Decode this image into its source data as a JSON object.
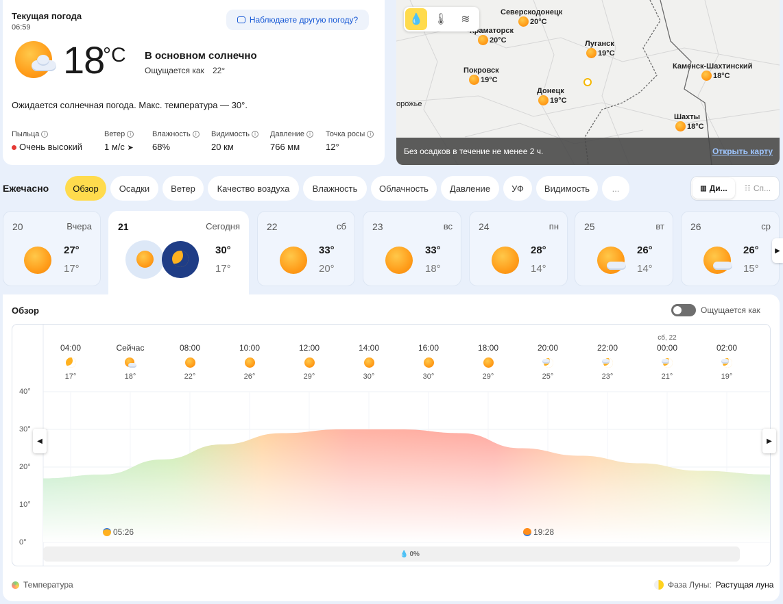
{
  "current": {
    "title": "Текущая погода",
    "time": "06:59",
    "feedback_label": "Наблюдаете другую погоду?",
    "temp": "18",
    "unit": "°C",
    "condition": "В основном солнечно",
    "feels_label": "Ощущается как",
    "feels_value": "22°",
    "expectation": "Ожидается солнечная погода. Макс. температура — 30°.",
    "details": [
      {
        "label": "Пыльца",
        "value": "Очень высокий"
      },
      {
        "label": "Ветер",
        "value": "1 м/с"
      },
      {
        "label": "Влажность",
        "value": "68%"
      },
      {
        "label": "Видимость",
        "value": "20 км"
      },
      {
        "label": "Давление",
        "value": "766 мм"
      },
      {
        "label": "Точка росы",
        "value": "12°"
      }
    ],
    "pollen_color": "#e53935"
  },
  "map": {
    "tools": [
      "drop-icon",
      "thermometer-icon",
      "wind-icon"
    ],
    "cities": [
      {
        "name": "Северскодонецк",
        "temp": "20°C"
      },
      {
        "name": "Краматорск",
        "temp": "20°C"
      },
      {
        "name": "Луганск",
        "temp": "19°C"
      },
      {
        "name": "Каменск-Шахтинский",
        "temp": "18°C"
      },
      {
        "name": "Покровск",
        "temp": "19°C"
      },
      {
        "name": "Донецк",
        "temp": "19°C"
      },
      {
        "name": "Шахты",
        "temp": "18°C"
      }
    ],
    "edge_label": "орожье",
    "status": "Без осадков в течение не менее 2 ч.",
    "open_link": "Открыть карту"
  },
  "hourly": {
    "label": "Ежечасно",
    "tabs": [
      "Обзор",
      "Осадки",
      "Ветер",
      "Качество воздуха",
      "Влажность",
      "Облачность",
      "Давление",
      "УФ",
      "Видимость",
      "..."
    ],
    "active_tab": "Обзор",
    "view_switch": [
      "Ди...",
      "Сп..."
    ]
  },
  "days": [
    {
      "num": "20",
      "name": "Вчера",
      "hi": "27°",
      "lo": "17°",
      "icon": "sun"
    },
    {
      "num": "21",
      "name": "Сегодня",
      "hi": "30°",
      "lo": "17°",
      "icon": "sun-moon"
    },
    {
      "num": "22",
      "name": "сб",
      "hi": "33°",
      "lo": "20°",
      "icon": "sun"
    },
    {
      "num": "23",
      "name": "вс",
      "hi": "33°",
      "lo": "18°",
      "icon": "sun"
    },
    {
      "num": "24",
      "name": "пн",
      "hi": "28°",
      "lo": "14°",
      "icon": "sun"
    },
    {
      "num": "25",
      "name": "вт",
      "hi": "26°",
      "lo": "14°",
      "icon": "sun-cloud"
    },
    {
      "num": "26",
      "name": "ср",
      "hi": "26°",
      "lo": "15°",
      "icon": "sun-cloud"
    }
  ],
  "overview": {
    "title": "Обзор",
    "feels_toggle": "Ощущается как",
    "hours": [
      {
        "date": "",
        "time": "04:00",
        "temp": "17°",
        "icon": "moon"
      },
      {
        "date": "",
        "time": "Сейчас",
        "temp": "18°",
        "icon": "sun-cloud"
      },
      {
        "date": "",
        "time": "08:00",
        "temp": "22°",
        "icon": "sun"
      },
      {
        "date": "",
        "time": "10:00",
        "temp": "26°",
        "icon": "sun"
      },
      {
        "date": "",
        "time": "12:00",
        "temp": "29°",
        "icon": "sun"
      },
      {
        "date": "",
        "time": "14:00",
        "temp": "30°",
        "icon": "sun"
      },
      {
        "date": "",
        "time": "16:00",
        "temp": "30°",
        "icon": "sun"
      },
      {
        "date": "",
        "time": "18:00",
        "temp": "29°",
        "icon": "sun"
      },
      {
        "date": "",
        "time": "20:00",
        "temp": "25°",
        "icon": "moon-cloud"
      },
      {
        "date": "",
        "time": "22:00",
        "temp": "23°",
        "icon": "moon-cloud"
      },
      {
        "date": "сб, 22",
        "time": "00:00",
        "temp": "21°",
        "icon": "moon-cloud"
      },
      {
        "date": "",
        "time": "02:00",
        "temp": "19°",
        "icon": "moon-cloud"
      }
    ],
    "sunrise": "05:26",
    "sunset": "19:28",
    "precip": "0%",
    "legend": "Температура",
    "moon_label": "Фаза Луны:",
    "moon_value": "Растущая луна"
  },
  "chart_data": {
    "type": "area",
    "ylabel": "",
    "y_ticks": [
      "40°",
      "30°",
      "20°",
      "10°",
      "0°"
    ],
    "ylim": [
      0,
      40
    ],
    "x": [
      "04:00",
      "Сейчас",
      "08:00",
      "10:00",
      "12:00",
      "14:00",
      "16:00",
      "18:00",
      "20:00",
      "22:00",
      "00:00",
      "02:00"
    ],
    "series": [
      {
        "name": "Температура",
        "values": [
          17,
          18,
          22,
          26,
          29,
          30,
          30,
          29,
          25,
          23,
          21,
          19
        ]
      }
    ]
  }
}
